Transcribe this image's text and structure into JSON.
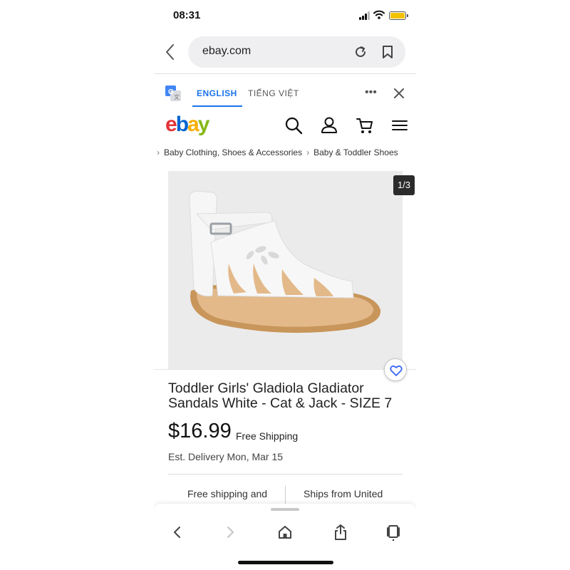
{
  "status_bar": {
    "time": "08:31",
    "battery_color": "#f3c300"
  },
  "browser": {
    "url": "ebay.com",
    "icons": [
      "chevron-left-icon",
      "reload-icon",
      "bookmark-icon"
    ]
  },
  "translate_bar": {
    "active_language": "ENGLISH",
    "other_language": "TIẾNG VIỆT",
    "accent_color": "#1a73e8"
  },
  "header": {
    "logo": {
      "e": "e",
      "b": "b",
      "a": "a",
      "y": "y"
    },
    "logo_colors": [
      "#e53238",
      "#0064d2",
      "#f5af02",
      "#86b817"
    ],
    "icons": [
      "search-icon",
      "account-icon",
      "cart-icon",
      "menu-icon"
    ]
  },
  "breadcrumb": {
    "items": [
      "Baby Clothing, Shoes & Accessories",
      "Baby & Toddler Shoes"
    ]
  },
  "gallery": {
    "counter": "1/3"
  },
  "product": {
    "title": "Toddler Girls' Gladiola Gladiator Sandals White - Cat & Jack - SIZE 7",
    "price": "$16.99",
    "shipping": "Free Shipping",
    "delivery": "Est. Delivery Mon, Mar 15",
    "info_left": "Free shipping and",
    "info_right": "Ships from United"
  },
  "toolbar": {
    "icons": [
      "back-icon",
      "forward-icon",
      "home-icon",
      "share-icon",
      "tabs-icon"
    ]
  }
}
